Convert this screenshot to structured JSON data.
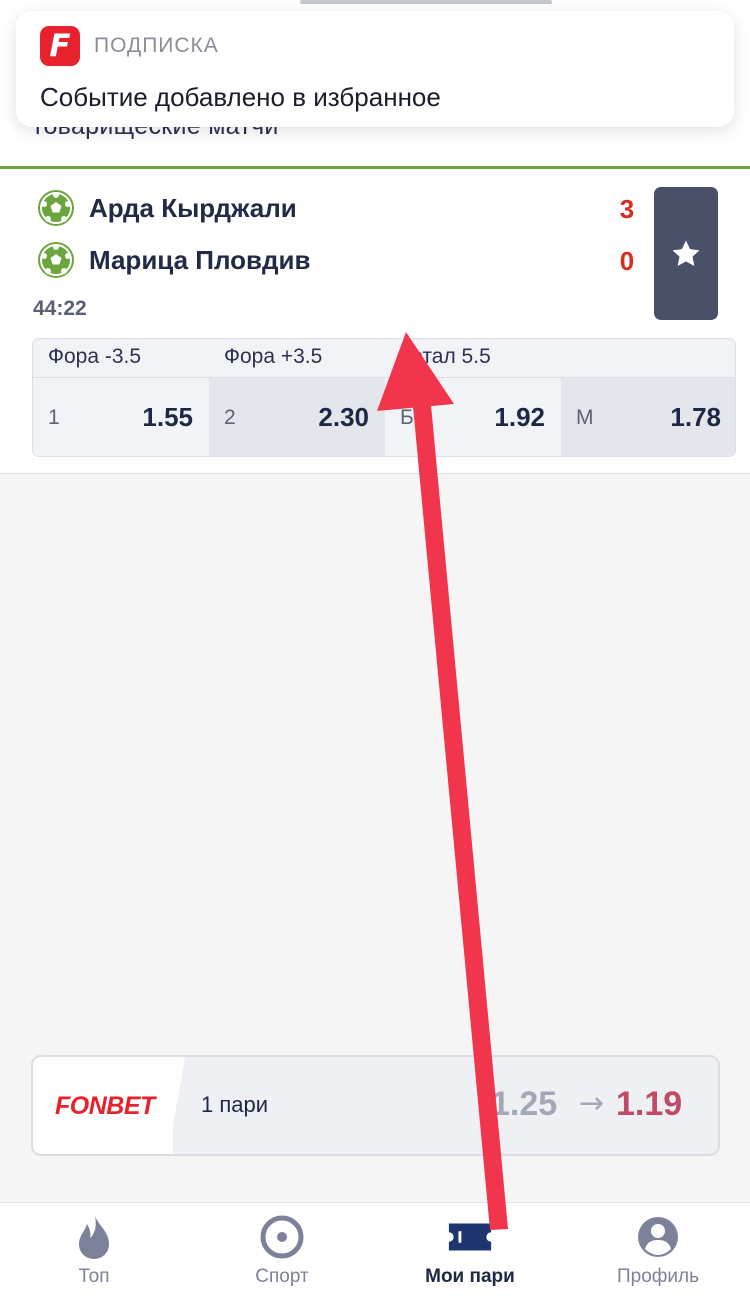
{
  "notification": {
    "app_icon_letter": "F",
    "app_name": "ПОДПИСКА",
    "message": "Событие добавлено в избранное"
  },
  "section": {
    "title": "товарищеские матчи"
  },
  "event": {
    "teams": [
      {
        "name": "Арда Кырджали",
        "score": "3",
        "icon": "soccer-ball-icon"
      },
      {
        "name": "Марица Пловдив",
        "score": "0",
        "icon": "soccer-ball-icon"
      }
    ],
    "time": "44:22",
    "favorite_icon": "star-icon",
    "markets": [
      {
        "label": "Фора -3.5"
      },
      {
        "label": "Фора +3.5"
      },
      {
        "label": "Тотал 5.5"
      }
    ],
    "odds": [
      {
        "label": "1",
        "value": "1.55"
      },
      {
        "label": "2",
        "value": "2.30"
      },
      {
        "label": "Б",
        "value": "1.92"
      },
      {
        "label": "М",
        "value": "1.78"
      }
    ]
  },
  "coupon": {
    "brand": "FONBET",
    "count": "1 пари",
    "old_odds": "1.25",
    "arrow": "→",
    "new_odds": "1.19"
  },
  "nav": {
    "items": [
      {
        "label": "Топ",
        "icon": "flame-icon",
        "active": false
      },
      {
        "label": "Спорт",
        "icon": "target-icon",
        "active": false
      },
      {
        "label": "Мои пари",
        "icon": "ticket-icon",
        "active": true
      },
      {
        "label": "Профиль",
        "icon": "profile-icon",
        "active": false
      }
    ]
  },
  "colors": {
    "accent_red": "#e8222c",
    "score_red": "#dc2a1f",
    "nav_dark": "#1f2746",
    "annotation_arrow": "#f0354d",
    "ball_green": "#6aa63b"
  }
}
